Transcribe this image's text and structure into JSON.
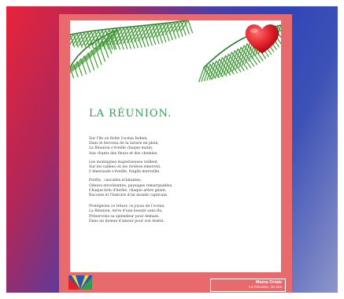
{
  "poster": {
    "title": "LA RÉUNION.",
    "stanzas": [
      [
        "Sur l'île où flotte l'océan Indien,",
        "Dans le berceau de la nature en plein,",
        "La Réunion s'éveille chaque matin,",
        "Aux chants des fleurs et des chemins."
      ],
      [
        "Les montagnes majestueuses veillent,",
        "Sur les vallées où les rivières émerveil,",
        "L'émeraude s'éveille, fragile merveille."
      ],
      [
        "Forêts , cascades éclatantes,",
        "Odeurs envoûtantes, paysages remarquables,",
        "Chaque brin d'herbe, chaque arbre géant,",
        "Raconte et l'histoire d'un monde captivant."
      ],
      [
        "Protégeons ce trésor, ce joyau de l'océan,",
        "La Réunion, terre d'une beauté sans fin,",
        "Préservons sa splendeur pour demain,",
        "Dans un hymne d'amour pour son destin."
      ]
    ],
    "credit": {
      "name": "Maina Ortale",
      "place": "La Réunion, 10 ans"
    }
  },
  "colors": {
    "title": "#2e9e4c",
    "frame": "#e86a6c",
    "heart": "#e2202b"
  },
  "icons": [
    "palm-leaves-decoration",
    "heart-icon",
    "reunion-flag-icon"
  ]
}
